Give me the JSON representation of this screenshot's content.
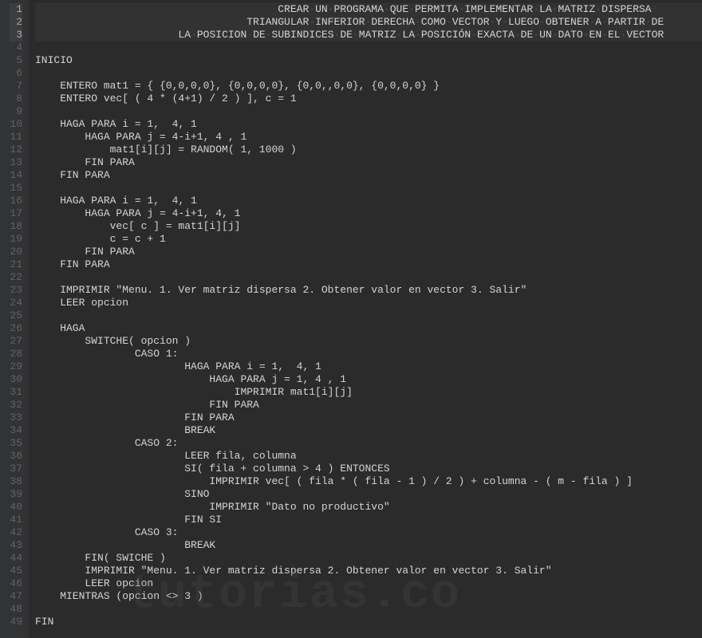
{
  "watermark": "tutorias.co",
  "lines": [
    {
      "num": 1,
      "text": "                                       CREAR·UN·PROGRAMA·QUE·PERMITA·IMPLEMENTAR·LA·MATRIZ·DISPERSA",
      "active": true
    },
    {
      "num": 2,
      "text": "                                  TRIANGULAR·INFERIOR·DERECHA·COMO·VECTOR·Y·LUEGO·OBTENER·A·PARTIR·DE",
      "active": true
    },
    {
      "num": 3,
      "text": "                       LA·POSICION·DE·SUBINDICES·DE·MATRIZ·LA·POSICIÓN·EXACTA·DE·UN·DATO·EN·EL·VECTOR",
      "active": true
    },
    {
      "num": 4,
      "text": "",
      "active": false
    },
    {
      "num": 5,
      "text": "INICIO",
      "active": false
    },
    {
      "num": 6,
      "text": "",
      "active": false
    },
    {
      "num": 7,
      "text": "    ENTERO mat1 = { {0,0,0,0}, {0,0,0,0}, {0,0,,0,0}, {0,0,0,0} }",
      "active": false
    },
    {
      "num": 8,
      "text": "    ENTERO vec[ ( 4 * (4+1) / 2 ) ], c = 1",
      "active": false
    },
    {
      "num": 9,
      "text": "",
      "active": false
    },
    {
      "num": 10,
      "text": "    HAGA PARA i = 1,  4, 1",
      "active": false
    },
    {
      "num": 11,
      "text": "        HAGA PARA j = 4-i+1, 4 , 1",
      "active": false
    },
    {
      "num": 12,
      "text": "            mat1[i][j] = RANDOM( 1, 1000 )",
      "active": false
    },
    {
      "num": 13,
      "text": "        FIN PARA",
      "active": false
    },
    {
      "num": 14,
      "text": "    FIN PARA",
      "active": false
    },
    {
      "num": 15,
      "text": "",
      "active": false
    },
    {
      "num": 16,
      "text": "    HAGA PARA i = 1,  4, 1",
      "active": false
    },
    {
      "num": 17,
      "text": "        HAGA PARA j = 4-i+1, 4, 1",
      "active": false
    },
    {
      "num": 18,
      "text": "            vec[ c ] = mat1[i][j]",
      "active": false
    },
    {
      "num": 19,
      "text": "            c = c + 1",
      "active": false
    },
    {
      "num": 20,
      "text": "        FIN PARA",
      "active": false
    },
    {
      "num": 21,
      "text": "    FIN PARA",
      "active": false
    },
    {
      "num": 22,
      "text": "",
      "active": false
    },
    {
      "num": 23,
      "text": "    IMPRIMIR \"Menu. 1. Ver matriz dispersa 2. Obtener valor en vector 3. Salir\"",
      "active": false
    },
    {
      "num": 24,
      "text": "    LEER opcion",
      "active": false
    },
    {
      "num": 25,
      "text": "",
      "active": false
    },
    {
      "num": 26,
      "text": "    HAGA",
      "active": false
    },
    {
      "num": 27,
      "text": "        SWITCHE( opcion )",
      "active": false
    },
    {
      "num": 28,
      "text": "                CASO 1:",
      "active": false
    },
    {
      "num": 29,
      "text": "                        HAGA PARA i = 1,  4, 1",
      "active": false
    },
    {
      "num": 30,
      "text": "                            HAGA PARA j = 1, 4 , 1",
      "active": false
    },
    {
      "num": 31,
      "text": "                                IMPRIMIR mat1[i][j]",
      "active": false
    },
    {
      "num": 32,
      "text": "                            FIN PARA",
      "active": false
    },
    {
      "num": 33,
      "text": "                        FIN PARA",
      "active": false
    },
    {
      "num": 34,
      "text": "                        BREAK",
      "active": false
    },
    {
      "num": 35,
      "text": "                CASO 2:",
      "active": false
    },
    {
      "num": 36,
      "text": "                        LEER fila, columna",
      "active": false
    },
    {
      "num": 37,
      "text": "                        SI( fila + columna > 4 ) ENTONCES",
      "active": false
    },
    {
      "num": 38,
      "text": "                            IMPRIMIR vec[ ( fila * ( fila - 1 ) / 2 ) + columna - ( m - fila ) ]",
      "active": false
    },
    {
      "num": 39,
      "text": "                        SINO",
      "active": false
    },
    {
      "num": 40,
      "text": "                            IMPRIMIR \"Dato no productivo\"",
      "active": false
    },
    {
      "num": 41,
      "text": "                        FIN SI",
      "active": false
    },
    {
      "num": 42,
      "text": "                CASO 3:",
      "active": false
    },
    {
      "num": 43,
      "text": "                        BREAK",
      "active": false
    },
    {
      "num": 44,
      "text": "        FIN( SWICHE )",
      "active": false
    },
    {
      "num": 45,
      "text": "        IMPRIMIR \"Menu. 1. Ver matriz dispersa 2. Obtener valor en vector 3. Salir\"",
      "active": false
    },
    {
      "num": 46,
      "text": "        LEER opcion",
      "active": false
    },
    {
      "num": 47,
      "text": "    MIENTRAS (opcion <> 3 )",
      "active": false
    },
    {
      "num": 48,
      "text": "",
      "active": false
    },
    {
      "num": 49,
      "text": "FIN",
      "active": false
    }
  ]
}
